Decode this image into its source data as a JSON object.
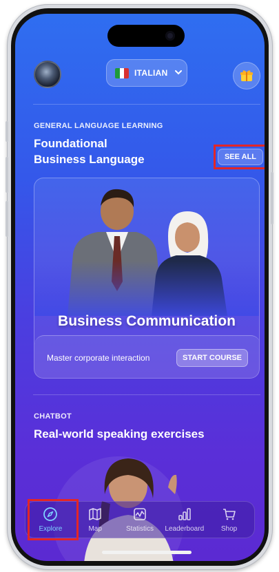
{
  "header": {
    "language_label": "ITALIAN",
    "flag_colors": [
      "#1e9a3a",
      "#ffffff",
      "#d83030"
    ]
  },
  "featured": {
    "category_label": "GENERAL LANGUAGE LEARNING",
    "title_line1": "Foundational",
    "title_line2": "Business Language",
    "see_all_label": "SEE ALL"
  },
  "course_card": {
    "title": "Business Communication",
    "description": "Master corporate interaction",
    "start_label": "START COURSE"
  },
  "chatbot": {
    "category_label": "CHATBOT",
    "title": "Real-world speaking exercises"
  },
  "nav": {
    "items": [
      {
        "label": "Explore",
        "icon": "compass-icon",
        "active": true
      },
      {
        "label": "Map",
        "icon": "map-icon"
      },
      {
        "label": "Statistics",
        "icon": "statistics-icon"
      },
      {
        "label": "Leaderboard",
        "icon": "leaderboard-icon"
      },
      {
        "label": "Shop",
        "icon": "cart-icon"
      }
    ]
  },
  "colors": {
    "active_tab": "#7fd3ff",
    "highlight_box": "#e32626"
  }
}
